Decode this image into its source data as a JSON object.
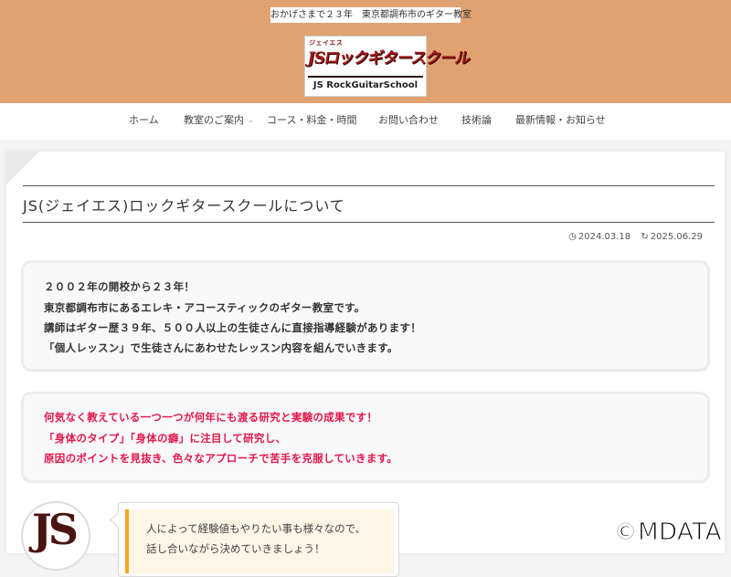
{
  "header": {
    "tagline": "おかげさまで２３年　東京都調布市のギター教室",
    "logo": {
      "small_text": "ジェイエス",
      "main_text": "JSロックギタースクール",
      "sub_text": "JS RockGuitarSchool"
    }
  },
  "nav": {
    "items": [
      {
        "label": "ホーム"
      },
      {
        "label": "教室のご案内",
        "has_dropdown": true
      },
      {
        "label": "コース・料金・時間"
      },
      {
        "label": "お問い合わせ"
      },
      {
        "label": "技術論"
      },
      {
        "label": "最新情報・お知らせ"
      }
    ]
  },
  "article": {
    "title": "JS(ジェイエス)ロックギタースクールについて",
    "published": "2024.03.18",
    "updated": "2025.06.29",
    "intro_box": [
      "２００２年の開校から２３年！",
      "東京都調布市にあるエレキ・アコースティックのギター教室です。",
      "講師はギター歴３９年、５００人以上の生徒さんに直接指導経験があります！",
      "「個人レッスン」で生徒さんにあわせたレッスン内容を組んでいきます。"
    ],
    "highlight_box": [
      "何気なく教えている一つ一つが何年にも渡る研究と実験の成果です！",
      "「身体のタイプ」「身体の癖」に注目して研究し、",
      "原因のポイントを見抜き、色々なアプローチで苦手を克服していきます。"
    ],
    "speech": {
      "avatar_text": "JS",
      "lines": [
        "人によって経験値もやりたい事も様々なので、",
        "話し合いながら決めていきましょう！"
      ]
    }
  },
  "watermark": "©MDATA",
  "colors": {
    "header_bg": "#e1a272",
    "highlight_text": "#e3154a",
    "speech_accent": "#f5a623"
  }
}
